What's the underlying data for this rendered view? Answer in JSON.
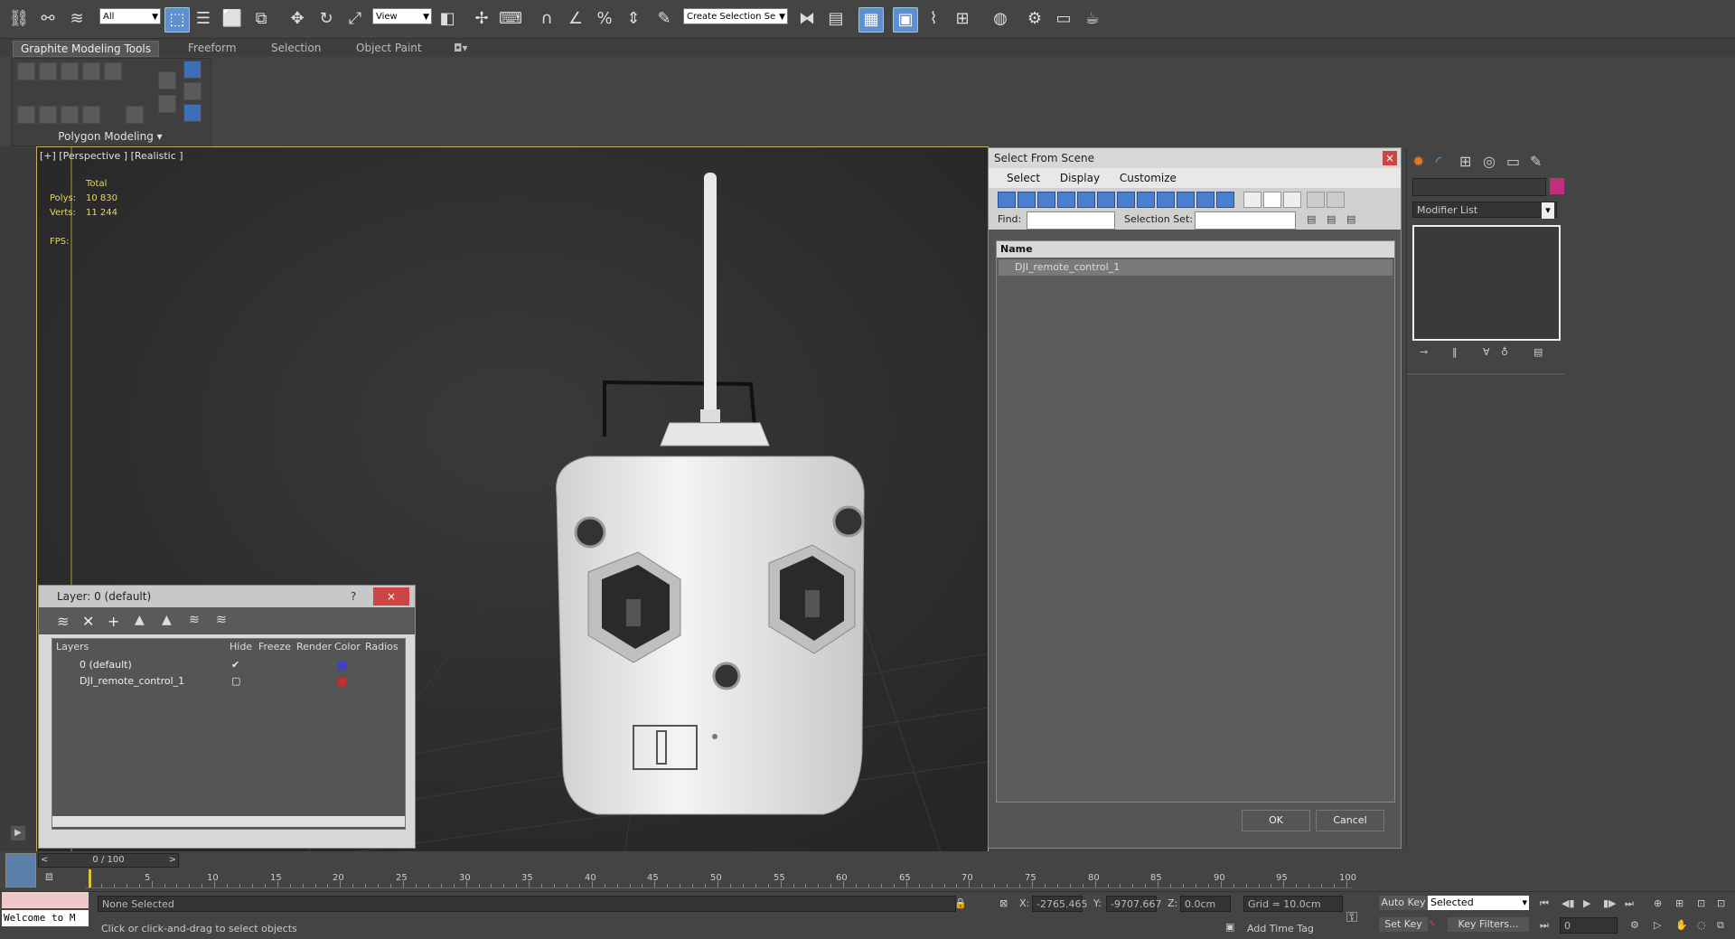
{
  "toolbar": {
    "selection_filter": "All",
    "ref_coord": "View",
    "named_sel_placeholder": "Create Selection Se"
  },
  "ribbon": {
    "tabs": [
      "Graphite Modeling Tools",
      "Freeform",
      "Selection",
      "Object Paint"
    ],
    "panel_title": "Polygon Modeling"
  },
  "viewport": {
    "label": "[+] [Perspective ] [Realistic ]",
    "stats": {
      "total_label": "Total",
      "polys_label": "Polys:",
      "polys": "10 830",
      "verts_label": "Verts:",
      "verts": "11 244",
      "fps_label": "FPS:"
    }
  },
  "layer_dialog": {
    "title": "Layer: 0 (default)",
    "help": "?",
    "close": "×",
    "columns": [
      "Layers",
      "Hide",
      "Freeze",
      "Render",
      "Color",
      "Radios"
    ],
    "rows": [
      {
        "name": "0 (default)",
        "color": "#4040c0"
      },
      {
        "name": "DJI_remote_control_1",
        "color": "#c03030"
      }
    ]
  },
  "select_from_scene": {
    "title": "Select From Scene",
    "menu": [
      "Select",
      "Display",
      "Customize"
    ],
    "find_label": "Find:",
    "selection_set_label": "Selection Set:",
    "column_name": "Name",
    "items": [
      "DJI_remote_control_1"
    ],
    "ok": "OK",
    "cancel": "Cancel"
  },
  "command_panel": {
    "modifier_list": "Modifier List",
    "color": "#c0307a"
  },
  "timeline": {
    "frame": "0 / 100",
    "ticks": [
      "5",
      "10",
      "15",
      "20",
      "25",
      "30",
      "35",
      "40",
      "45",
      "50",
      "55",
      "60",
      "65",
      "70",
      "75",
      "80",
      "85",
      "90",
      "95",
      "100"
    ]
  },
  "status": {
    "maxscript": "Welcome to M",
    "none_selected": "None Selected",
    "prompt": "Click or click-and-drag to select objects",
    "x_label": "X:",
    "x_value": "-2765.465",
    "y_label": "Y:",
    "y_value": "-9707.667",
    "z_label": "Z:",
    "z_value": "0.0cm",
    "grid": "Grid = 10.0cm",
    "add_time_tag": "Add Time Tag",
    "auto_key": "Auto Key",
    "set_key": "Set Key",
    "selected": "Selected",
    "key_filters": "Key Filters...",
    "frame_field": "0"
  }
}
